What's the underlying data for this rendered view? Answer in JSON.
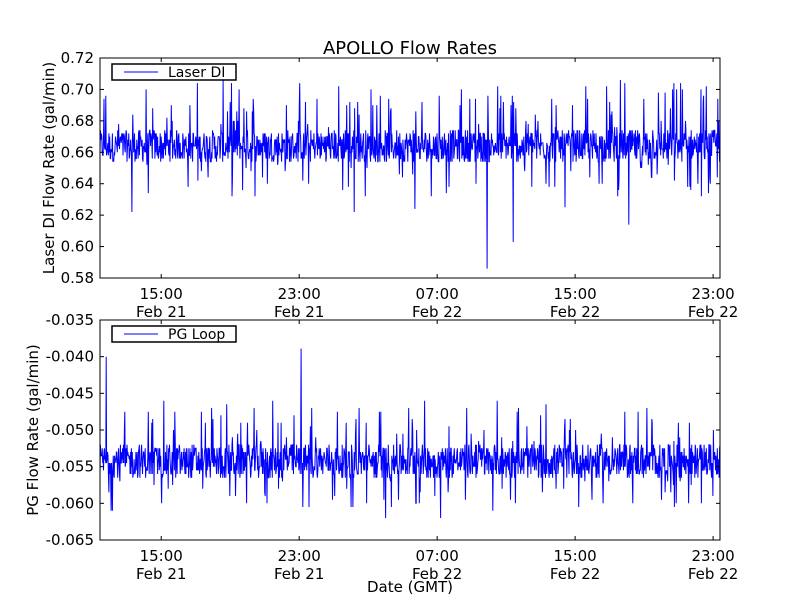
{
  "chart_data": [
    {
      "type": "line",
      "title": "APOLLO Flow Rates",
      "xlabel": "",
      "ylabel": "Laser DI Flow Rate (gal/min)",
      "ylim": [
        0.58,
        0.72
      ],
      "yticks": [
        "0.58",
        "0.60",
        "0.62",
        "0.64",
        "0.66",
        "0.68",
        "0.70",
        "0.72"
      ],
      "ytick_values": [
        0.58,
        0.6,
        0.62,
        0.64,
        0.66,
        0.68,
        0.7,
        0.72
      ],
      "xlim_hours_from_feb21_0000": [
        11.45,
        47.4
      ],
      "xticks": [
        {
          "time": "15:00",
          "date": "Feb 21",
          "hour": 15
        },
        {
          "time": "23:00",
          "date": "Feb 21",
          "hour": 23
        },
        {
          "time": "07:00",
          "date": "Feb 22",
          "hour": 31
        },
        {
          "time": "15:00",
          "date": "Feb 22",
          "hour": 39
        },
        {
          "time": "23:00",
          "date": "Feb 22",
          "hour": 47
        }
      ],
      "legend": {
        "label": "Laser DI",
        "placement": "top-left"
      },
      "color": "#0000ff",
      "grid": false,
      "series": {
        "name": "Laser DI",
        "baseline": 0.664,
        "typical_range": [
          0.654,
          0.674
        ],
        "occasional_range": [
          0.632,
          0.706
        ],
        "quantum": 0.002,
        "spikes": [
          {
            "hour": 13.3,
            "value": 0.622
          },
          {
            "hour": 26.2,
            "value": 0.622
          },
          {
            "hour": 29.7,
            "value": 0.624
          },
          {
            "hour": 33.9,
            "value": 0.586
          },
          {
            "hour": 35.4,
            "value": 0.603
          },
          {
            "hour": 38.4,
            "value": 0.625
          },
          {
            "hour": 42.1,
            "value": 0.614
          }
        ]
      }
    },
    {
      "type": "line",
      "xlabel": "Date (GMT)",
      "ylabel": "PG Flow Rate (gal/min)",
      "ylim": [
        -0.065,
        -0.035
      ],
      "yticks": [
        "-0.065",
        "-0.060",
        "-0.055",
        "-0.050",
        "-0.045",
        "-0.040",
        "-0.035"
      ],
      "ytick_values": [
        -0.065,
        -0.06,
        -0.055,
        -0.05,
        -0.045,
        -0.04,
        -0.035
      ],
      "xlim_hours_from_feb21_0000": [
        11.45,
        47.4
      ],
      "xticks": [
        {
          "time": "15:00",
          "date": "Feb 21",
          "hour": 15
        },
        {
          "time": "23:00",
          "date": "Feb 21",
          "hour": 23
        },
        {
          "time": "07:00",
          "date": "Feb 22",
          "hour": 31
        },
        {
          "time": "15:00",
          "date": "Feb 22",
          "hour": 39
        },
        {
          "time": "23:00",
          "date": "Feb 22",
          "hour": 47
        }
      ],
      "legend": {
        "label": "PG Loop",
        "placement": "top-left"
      },
      "color": "#0000ff",
      "grid": false,
      "series": {
        "name": "PG Loop",
        "baseline": -0.0545,
        "typical_range": [
          -0.0565,
          -0.052
        ],
        "occasional_range": [
          -0.061,
          -0.046
        ],
        "quantum": 0.0005,
        "spikes": [
          {
            "hour": 11.8,
            "value": -0.04
          },
          {
            "hour": 23.1,
            "value": -0.0389
          },
          {
            "hour": 28.0,
            "value": -0.062
          },
          {
            "hour": 31.2,
            "value": -0.062
          }
        ]
      }
    }
  ]
}
